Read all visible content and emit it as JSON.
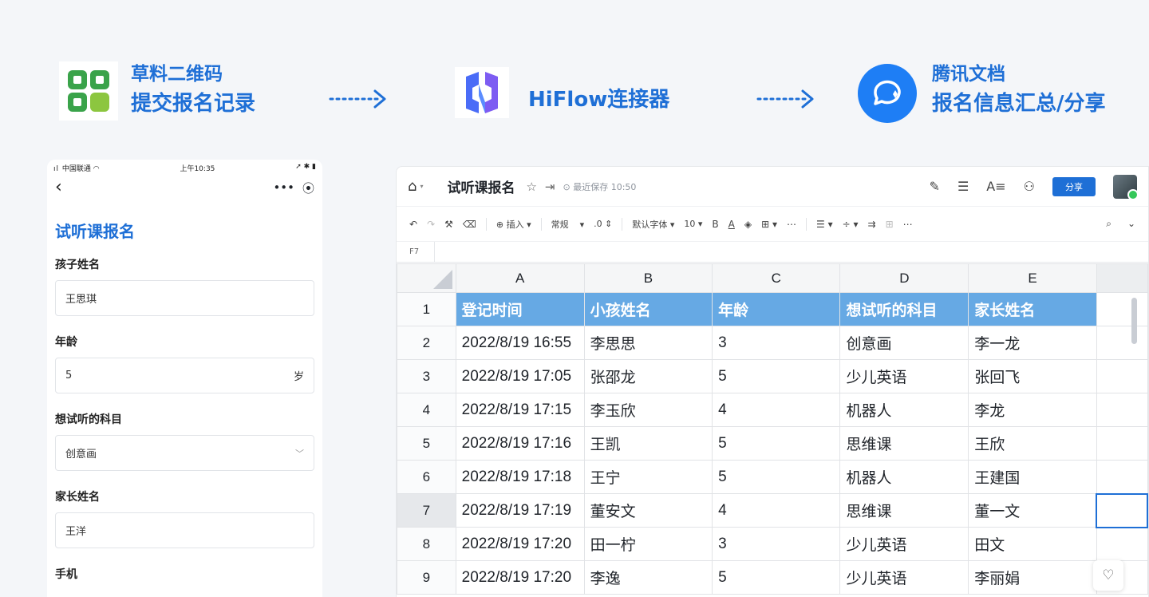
{
  "flow": {
    "step1": {
      "line1": "草料二维码",
      "line2": "提交报名记录",
      "logo": "caoliao-qr-logo"
    },
    "step2": {
      "label": "HiFlow连接器",
      "logo": "hiflow-logo"
    },
    "step3": {
      "line1": "腾讯文档",
      "line2": "报名信息汇总/分享",
      "logo": "tencent-docs-logo"
    },
    "arrow_icon": "dotted-arrow-right-icon",
    "accent_color": "#1e6fd6"
  },
  "phone": {
    "status": {
      "carrier": "中国联通",
      "time": "上午10:35"
    },
    "title": "试听课报名",
    "fields": [
      {
        "label": "孩子姓名",
        "value": "王思琪"
      },
      {
        "label": "年龄",
        "value": "5",
        "suffix": "岁"
      },
      {
        "label": "想试听的科目",
        "value": "创意画"
      },
      {
        "label": "家长姓名",
        "value": "王洋"
      },
      {
        "label": "手机",
        "value": ""
      }
    ]
  },
  "sheet": {
    "doc_title": "试听课报名",
    "save_state": "最近保存 10:50",
    "share_label": "分享",
    "toolbar": {
      "insert": "插入",
      "format": "常规",
      "decimal": ".0",
      "font": "默认字体",
      "font_size": "10"
    },
    "cell_ref": "F7",
    "columns": [
      "A",
      "B",
      "C",
      "D",
      "E"
    ],
    "rows": [
      {
        "n": "1",
        "cells": [
          "登记时间",
          "小孩姓名",
          "年龄",
          "想试听的科目",
          "家长姓名"
        ]
      },
      {
        "n": "2",
        "cells": [
          "2022/8/19 16:55",
          "李思思",
          "3",
          "创意画",
          "李一龙"
        ]
      },
      {
        "n": "3",
        "cells": [
          "2022/8/19 17:05",
          "张邵龙",
          "5",
          "少儿英语",
          "张回飞"
        ]
      },
      {
        "n": "4",
        "cells": [
          "2022/8/19 17:15",
          "李玉欣",
          "4",
          "机器人",
          "李龙"
        ]
      },
      {
        "n": "5",
        "cells": [
          "2022/8/19 17:16",
          "王凯",
          "5",
          "思维课",
          "王欣"
        ]
      },
      {
        "n": "6",
        "cells": [
          "2022/8/19 17:18",
          "王宁",
          "5",
          "机器人",
          "王建国"
        ]
      },
      {
        "n": "7",
        "cells": [
          "2022/8/19 17:19",
          "董安文",
          "4",
          "思维课",
          "董一文"
        ]
      },
      {
        "n": "8",
        "cells": [
          "2022/8/19 17:20",
          "田一柠",
          "3",
          "少儿英语",
          "田文"
        ]
      },
      {
        "n": "9",
        "cells": [
          "2022/8/19 17:20",
          "李逸",
          "5",
          "少儿英语",
          "李丽娟"
        ]
      }
    ]
  }
}
